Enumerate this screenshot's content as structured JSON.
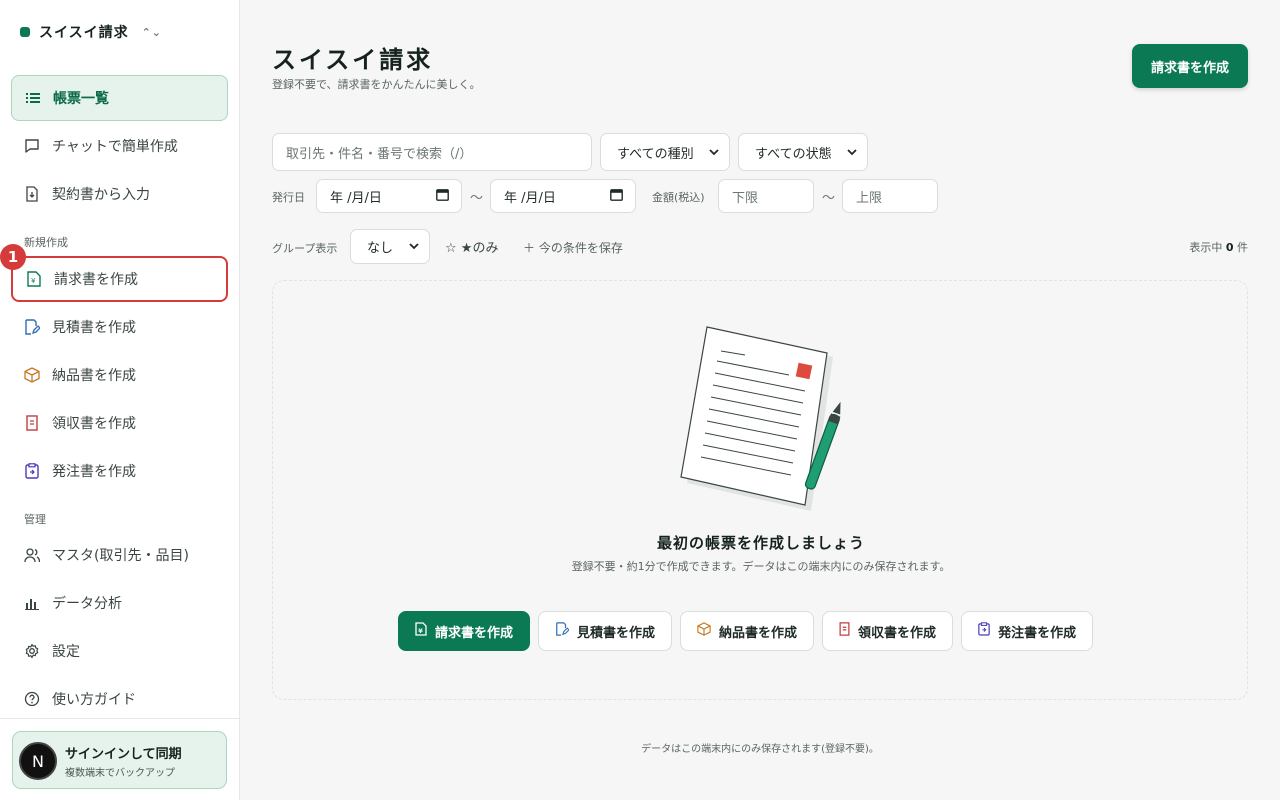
{
  "colors": {
    "brand": "#0b7a54",
    "highlight": "#d63b3b",
    "active_bg": "#e6f3ec"
  },
  "sidebar": {
    "brand": "スイスイ請求",
    "brand_switch_icon": "chevron-up-down-icon",
    "items_top": [
      {
        "label": "帳票一覧",
        "icon": "list-icon"
      },
      {
        "label": "チャットで簡単作成",
        "icon": "chat-icon"
      },
      {
        "label": "契約書から入力",
        "icon": "file-import-icon"
      }
    ],
    "section_new": "新規作成",
    "items_new": [
      {
        "label": "請求書を作成",
        "icon": "invoice-icon"
      },
      {
        "label": "見積書を作成",
        "icon": "quote-icon"
      },
      {
        "label": "納品書を作成",
        "icon": "box-icon"
      },
      {
        "label": "領収書を作成",
        "icon": "receipt-icon"
      },
      {
        "label": "発注書を作成",
        "icon": "clipboard-icon"
      }
    ],
    "section_manage": "管理",
    "items_manage": [
      {
        "label": "マスタ(取引先・品目)",
        "icon": "users-icon"
      },
      {
        "label": "データ分析",
        "icon": "bar-chart-icon"
      },
      {
        "label": "設定",
        "icon": "gear-icon"
      },
      {
        "label": "使い方ガイド",
        "icon": "help-icon"
      }
    ],
    "badge": "1",
    "signin": {
      "avatar": "N",
      "title": "サインインして同期",
      "subtitle": "複数端末でバックアップ"
    }
  },
  "header": {
    "title": "スイスイ請求",
    "subtitle": "登録不要で、請求書をかんたんに美しく。",
    "create_button": "請求書を作成"
  },
  "filters": {
    "search_placeholder": "取引先・件名・番号で検索（/）",
    "type_select": "すべての種別",
    "status_select": "すべての状態",
    "issue_date_label": "発行日",
    "date_placeholder": "年 /月/日",
    "range_sep": "～",
    "amount_label": "金額(税込)",
    "amount_min_placeholder": "下限",
    "amount_max_placeholder": "上限",
    "group_label": "グループ表示",
    "group_select": "なし",
    "star_only": "☆ ★のみ",
    "save_conditions": "＋ 今の条件を保存",
    "count_prefix": "表示中",
    "count_value": "0",
    "count_suffix": "件"
  },
  "empty_state": {
    "title": "最初の帳票を作成しましょう",
    "description": "登録不要・約1分で作成できます。データはこの端末内にのみ保存されます。",
    "buttons": [
      {
        "label": "請求書を作成",
        "icon": "invoice-icon"
      },
      {
        "label": "見積書を作成",
        "icon": "quote-icon"
      },
      {
        "label": "納品書を作成",
        "icon": "box-icon"
      },
      {
        "label": "領収書を作成",
        "icon": "receipt-icon"
      },
      {
        "label": "発注書を作成",
        "icon": "clipboard-icon"
      }
    ]
  },
  "footer_note": "データはこの端末内にのみ保存されます(登録不要)。"
}
